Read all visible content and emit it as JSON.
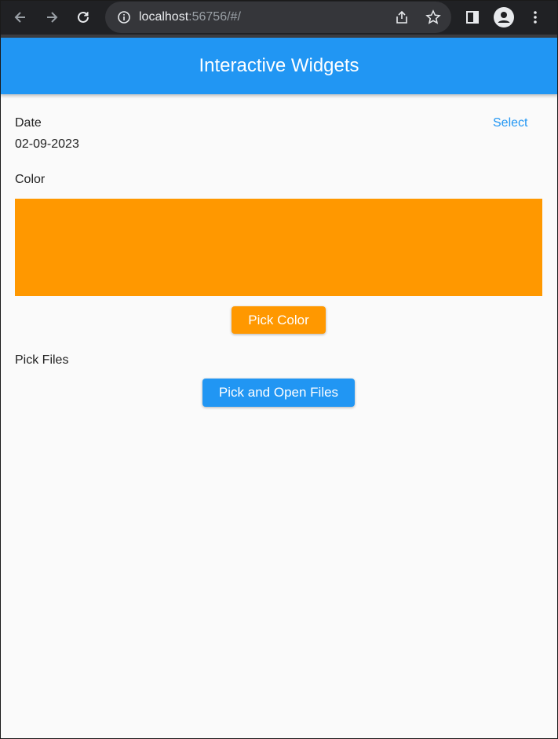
{
  "browser": {
    "url_host": "localhost",
    "url_rest": ":56756/#/",
    "icons": [
      "back-icon",
      "forward-icon",
      "reload-icon",
      "info-icon",
      "share-icon",
      "star-icon",
      "side-panel-icon",
      "profile-icon",
      "menu-icon"
    ]
  },
  "appbar": {
    "title": "Interactive Widgets"
  },
  "date_section": {
    "label": "Date",
    "value": "02-09-2023",
    "select_label": "Select"
  },
  "color_section": {
    "label": "Color",
    "selected_color": "#ff9800",
    "button_label": "Pick Color"
  },
  "files_section": {
    "label": "Pick Files",
    "button_label": "Pick and Open Files"
  },
  "colors": {
    "primary": "#2196f3",
    "accent": "#ff9800",
    "background": "#fafafa"
  }
}
